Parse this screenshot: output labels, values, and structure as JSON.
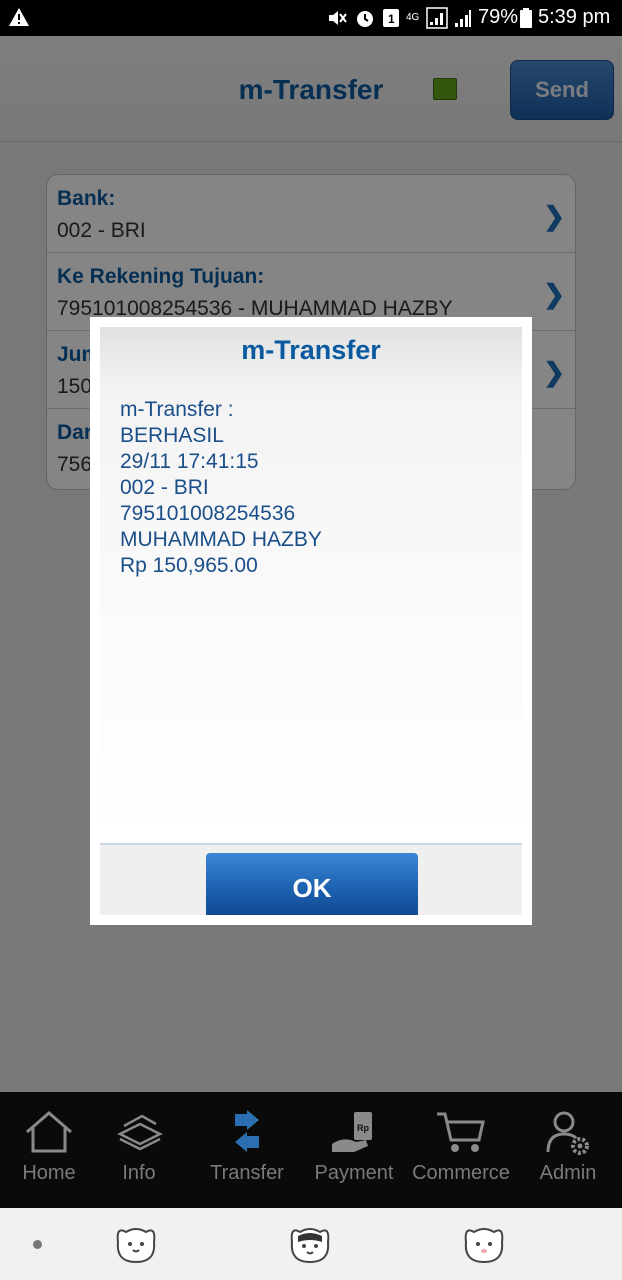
{
  "status_bar": {
    "battery": "79%",
    "time": "5:39 pm",
    "network": "4G"
  },
  "header": {
    "title": "m-Transfer",
    "send_label": "Send",
    "status_led_color": "#64a51d"
  },
  "form": {
    "rows": [
      {
        "label": "Bank:",
        "value": "002 - BRI"
      },
      {
        "label": "Ke Rekening Tujuan:",
        "value": "795101008254536 - MUHAMMAD HAZBY"
      },
      {
        "label": "Jumlah:",
        "value": "150,965.00"
      },
      {
        "label": "Dari Rekening:",
        "value": "756"
      }
    ]
  },
  "dialog": {
    "title": "m-Transfer",
    "lines": [
      "m-Transfer :",
      "BERHASIL",
      "29/11 17:41:15",
      "002 - BRI",
      "795101008254536",
      "MUHAMMAD HAZBY",
      "Rp 150,965.00"
    ],
    "ok_label": "OK"
  },
  "bottom_nav": {
    "items": [
      {
        "label": "Home",
        "icon": "home-icon"
      },
      {
        "label": "Info",
        "icon": "info-icon"
      },
      {
        "label": "Transfer",
        "icon": "transfer-icon"
      },
      {
        "label": "Payment",
        "icon": "payment-icon"
      },
      {
        "label": "Commerce",
        "icon": "commerce-icon"
      },
      {
        "label": "Admin",
        "icon": "admin-icon"
      }
    ]
  },
  "colors": {
    "brand_blue": "#0a5aa0",
    "button_blue": "#1b5fae"
  }
}
